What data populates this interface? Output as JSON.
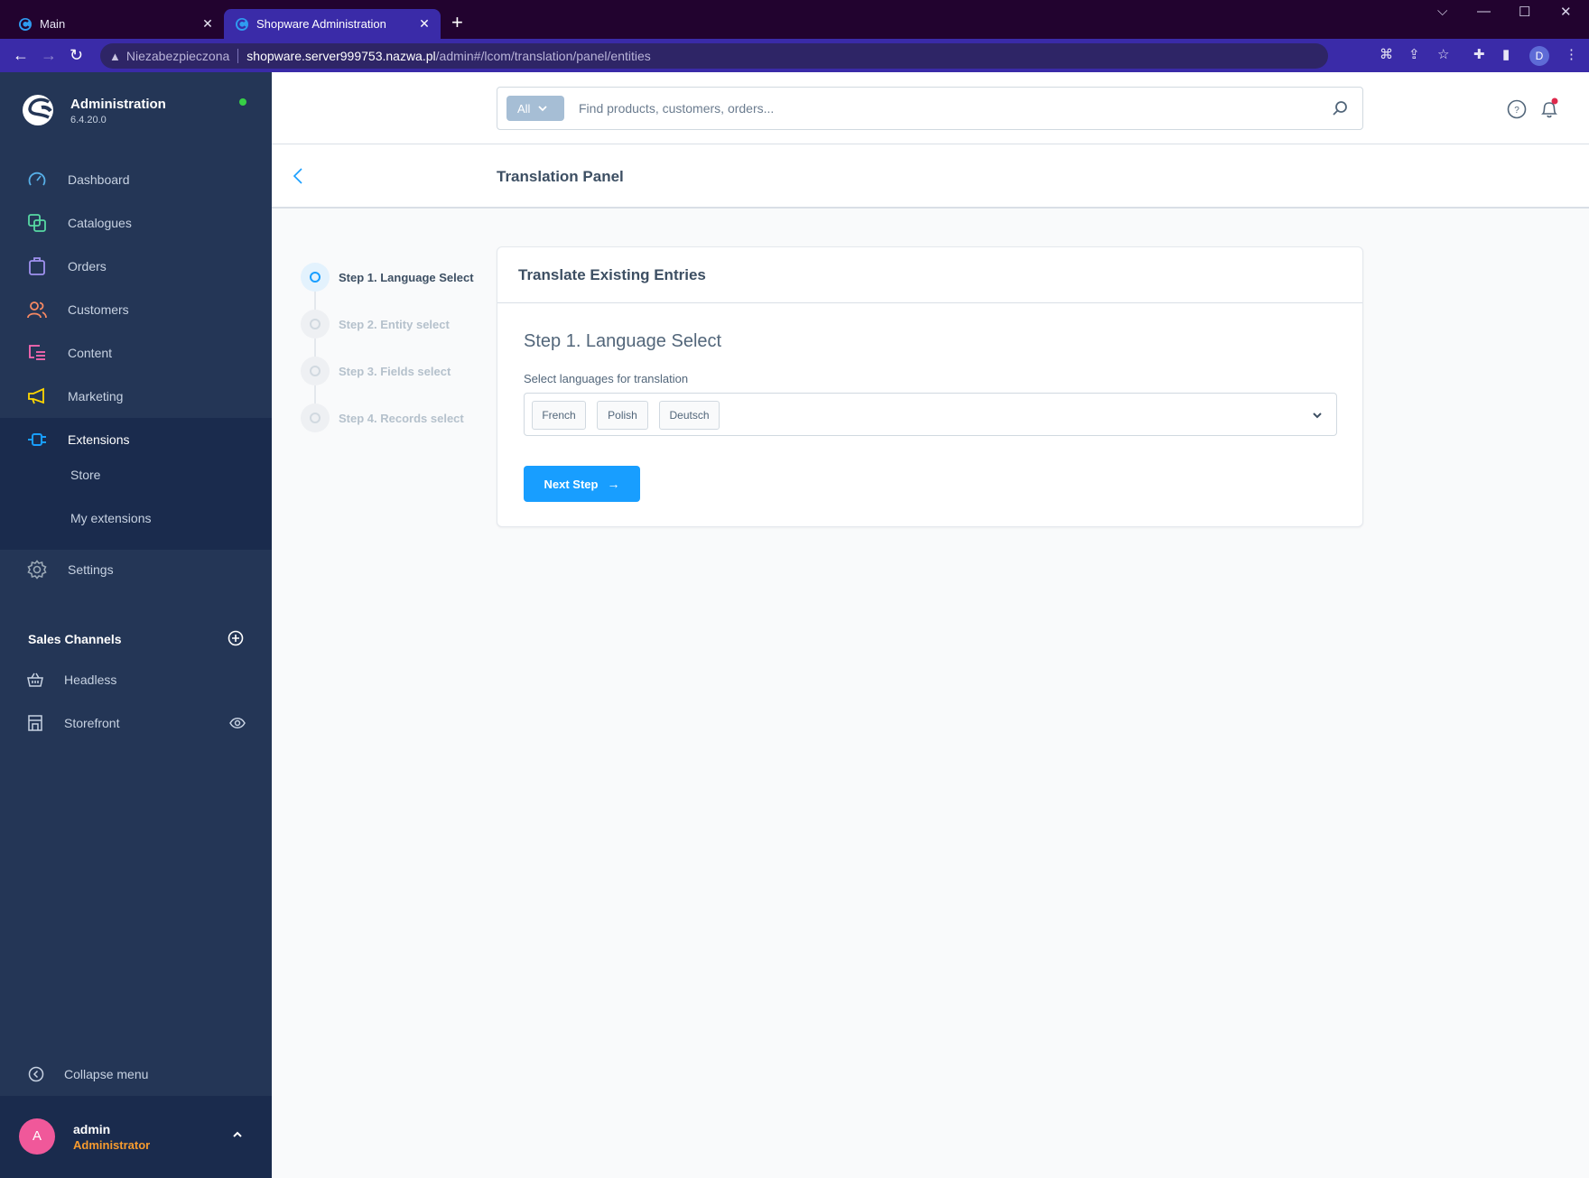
{
  "browser": {
    "tabs": [
      {
        "title": "Main",
        "active": false
      },
      {
        "title": "Shopware Administration",
        "active": true
      }
    ],
    "new_tab_icon": "plus-icon",
    "address": {
      "security_label": "Niezabezpieczona",
      "host": "shopware.server999753.nazwa.pl",
      "path": "/admin#/lcom/translation/panel/entities"
    },
    "profile_initial": "D"
  },
  "sidebar": {
    "app_title": "Administration",
    "version": "6.4.20.0",
    "status_color": "#37d046",
    "items": [
      {
        "label": "Dashboard",
        "icon": "dashboard-icon",
        "color": "#57b0e8"
      },
      {
        "label": "Catalogues",
        "icon": "catalogue-icon",
        "color": "#57d9a3"
      },
      {
        "label": "Orders",
        "icon": "orders-icon",
        "color": "#a092f0"
      },
      {
        "label": "Customers",
        "icon": "customers-icon",
        "color": "#f88962"
      },
      {
        "label": "Content",
        "icon": "content-icon",
        "color": "#ff68b4"
      },
      {
        "label": "Marketing",
        "icon": "marketing-icon",
        "color": "#ffd700"
      },
      {
        "label": "Extensions",
        "icon": "extensions-icon",
        "color": "#189eff",
        "active": true
      },
      {
        "label": "Settings",
        "icon": "settings-icon",
        "color": "#9aa8b5"
      }
    ],
    "extensions_children": [
      {
        "label": "Store"
      },
      {
        "label": "My extensions"
      }
    ],
    "sales_channels": {
      "heading": "Sales Channels",
      "items": [
        {
          "label": "Headless",
          "icon": "basket-icon"
        },
        {
          "label": "Storefront",
          "icon": "storefront-icon"
        }
      ]
    },
    "collapse_label": "Collapse menu",
    "user": {
      "initial": "A",
      "name": "admin",
      "role": "Administrator"
    }
  },
  "topbar": {
    "search_type": "All",
    "search_placeholder": "Find products, customers, orders..."
  },
  "smartbar": {
    "title": "Translation Panel"
  },
  "wizard": {
    "steps": [
      {
        "label": "Step 1. Language Select",
        "active": true
      },
      {
        "label": "Step 2. Entity select",
        "active": false
      },
      {
        "label": "Step 3. Fields select",
        "active": false
      },
      {
        "label": "Step 4. Records select",
        "active": false
      }
    ],
    "card_title": "Translate Existing Entries",
    "step_heading": "Step 1. Language Select",
    "field_label": "Select languages for translation",
    "selected_languages": [
      "French",
      "Polish",
      "Deutsch"
    ],
    "next_button": "Next Step",
    "next_arrow": "→"
  }
}
